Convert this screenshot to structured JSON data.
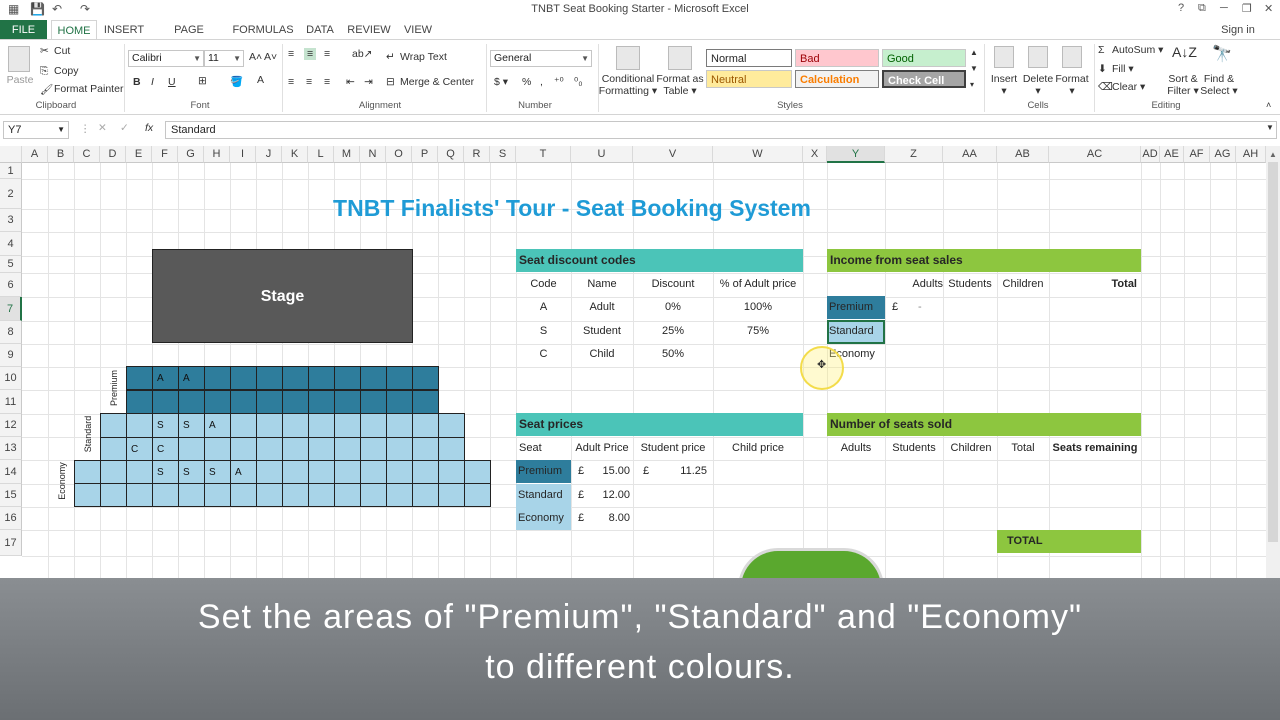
{
  "window": {
    "title": "TNBT Seat Booking Starter - Microsoft Excel",
    "help": "?",
    "signin": "Sign in"
  },
  "tabs": [
    "FILE",
    "HOME",
    "INSERT",
    "PAGE LAYOUT",
    "FORMULAS",
    "DATA",
    "REVIEW",
    "VIEW"
  ],
  "ribbon": {
    "clipboard": {
      "paste": "Paste",
      "cut": "Cut",
      "copy": "Copy",
      "format_painter": "Format Painter",
      "label": "Clipboard"
    },
    "font": {
      "name": "Calibri",
      "size": "11",
      "bold": "B",
      "italic": "I",
      "underline": "U",
      "label": "Font"
    },
    "alignment": {
      "wrap": "Wrap Text",
      "merge": "Merge & Center",
      "label": "Alignment"
    },
    "number": {
      "format": "General",
      "label": "Number"
    },
    "styles": {
      "cond1": "Conditional",
      "cond2": "Formatting",
      "fmt1": "Format as",
      "fmt2": "Table",
      "normal": "Normal",
      "bad": "Bad",
      "good": "Good",
      "neutral": "Neutral",
      "calculation": "Calculation",
      "check": "Check Cell",
      "label": "Styles"
    },
    "cells": {
      "insert": "Insert",
      "delete": "Delete",
      "format": "Format",
      "label": "Cells"
    },
    "editing": {
      "autosum": "AutoSum",
      "fill": "Fill",
      "clear": "Clear",
      "sort1": "Sort &",
      "sort2": "Filter",
      "find1": "Find &",
      "find2": "Select",
      "label": "Editing"
    }
  },
  "formula_bar": {
    "name_box": "Y7",
    "fx": "fx",
    "value": "Standard"
  },
  "columns": [
    "A",
    "B",
    "C",
    "D",
    "E",
    "F",
    "G",
    "H",
    "I",
    "J",
    "K",
    "L",
    "M",
    "N",
    "O",
    "P",
    "Q",
    "R",
    "S",
    "T",
    "U",
    "V",
    "W",
    "X",
    "Y",
    "Z",
    "AA",
    "AB",
    "AC",
    "AD",
    "AE",
    "AF",
    "AG",
    "AH"
  ],
  "rows": [
    "1",
    "2",
    "3",
    "4",
    "5",
    "6",
    "7",
    "8",
    "9",
    "10",
    "11",
    "12",
    "13",
    "14",
    "15",
    "16",
    "17"
  ],
  "sheet": {
    "title": "TNBT Finalists' Tour - Seat Booking System",
    "stage": "Stage",
    "section_labels": {
      "premium": "Premium",
      "standard": "Standard",
      "economy": "Economy"
    },
    "seat_marks": {
      "r9": [
        "A",
        "A"
      ],
      "r11": [
        "S",
        "S",
        "A"
      ],
      "r12": [
        "C",
        "C"
      ],
      "r13": [
        "S",
        "S",
        "S",
        "A"
      ]
    },
    "discount": {
      "header": "Seat discount codes",
      "cols": [
        "Code",
        "Name",
        "Discount",
        "% of Adult price"
      ],
      "rows": [
        [
          "A",
          "Adult",
          "0%",
          "100%"
        ],
        [
          "S",
          "Student",
          "25%",
          "75%"
        ],
        [
          "C",
          "Child",
          "50%",
          ""
        ]
      ]
    },
    "prices": {
      "header": "Seat prices",
      "cols": [
        "Seat",
        "Adult Price",
        "Student price",
        "Child price"
      ],
      "rows": [
        [
          "Premium",
          "£",
          "15.00",
          "£",
          "11.25"
        ],
        [
          "Standard",
          "£",
          "12.00",
          "",
          ""
        ],
        [
          "Economy",
          "£",
          "8.00",
          "",
          ""
        ]
      ]
    },
    "income": {
      "header": "Income from seat sales",
      "cols": [
        "Adults",
        "Students",
        "Children",
        "Total"
      ],
      "rows": [
        "Premium",
        "Standard",
        "Economy"
      ],
      "premium_cur": "£",
      "premium_val": "-"
    },
    "sold": {
      "header": "Number of seats sold",
      "cols": [
        "Adults",
        "Students",
        "Children",
        "Total",
        "Seats remaining"
      ],
      "total": "TOTAL"
    }
  },
  "subtitle": {
    "line1": "Set the areas of \"Premium\", \"Standard\" and \"Economy\"",
    "line2": "to different colours."
  },
  "colors": {
    "excel_green": "#217346",
    "teal": "#4bc4b8",
    "lime": "#8dc63f",
    "seat_dark": "#2e7d9c",
    "seat_light": "#a8d4e8",
    "stage": "#595959",
    "title_blue": "#1f9bd6"
  }
}
